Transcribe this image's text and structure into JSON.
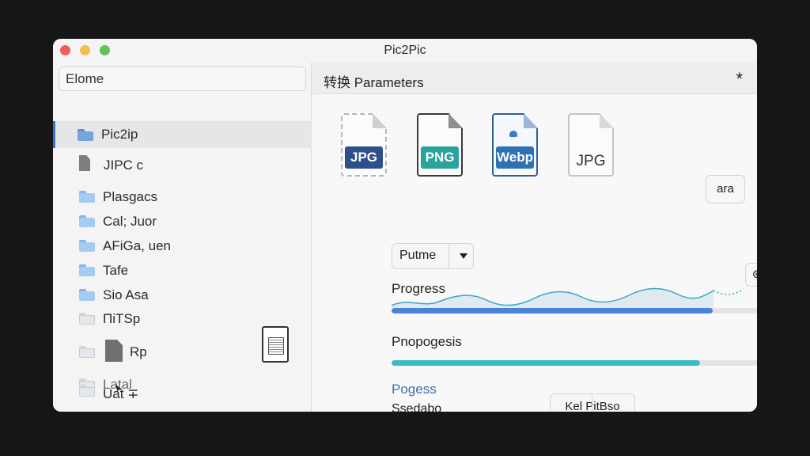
{
  "window": {
    "title": "Pic2Pic"
  },
  "sidebar": {
    "search_value": "Elome",
    "items": [
      {
        "label": "Pic2ip",
        "icon": "folder-icon",
        "selected": true
      },
      {
        "label": "JIPC c",
        "icon": "document-icon"
      },
      {
        "label": "Plasgacs",
        "icon": "folder-icon"
      },
      {
        "label": "Cal; Juor",
        "icon": "folder-icon"
      },
      {
        "label": "AFiGa, uen",
        "icon": "folder-icon"
      },
      {
        "label": "Tafe",
        "icon": "folder-icon"
      },
      {
        "label": "Sio Asa",
        "icon": "folder-icon"
      },
      {
        "label": "ΠiΤSp",
        "icon": "folder-icon"
      },
      {
        "label": "Rp",
        "icon": "document-icon"
      },
      {
        "label": "Latal",
        "icon": "folder-icon"
      },
      {
        "label": "Uat ∓",
        "icon": "folder-icon"
      }
    ]
  },
  "panel": {
    "title": "转换 Parameters",
    "close_glyph": "*",
    "formats": [
      {
        "label": "JPG",
        "color": "#2f4f8a",
        "icon": "jpg-file-icon"
      },
      {
        "label": "PNG",
        "color": "#2aa39a",
        "icon": "png-file-icon"
      },
      {
        "label": "Webp",
        "color": "#2f72b3",
        "icon": "webp-file-icon"
      },
      {
        "label": "JPG",
        "color": "",
        "icon": "jpg-file-icon"
      }
    ],
    "extra_button": "ara",
    "dropdown_value": "Putme",
    "progress_label": "Progress",
    "progress_value": 0.8,
    "control_glyph_1": "⊛",
    "control_glyph_2": "$",
    "progress2_label": "Pnopogesis",
    "progress2_value": 0.77,
    "link_label": "Pogess",
    "action_button": "Kel PitBso",
    "status_text": "Ssedabo"
  },
  "colors": {
    "accent_blue": "#4a84d6",
    "teal": "#3cbcc0",
    "wave": "#3aa6c8"
  }
}
